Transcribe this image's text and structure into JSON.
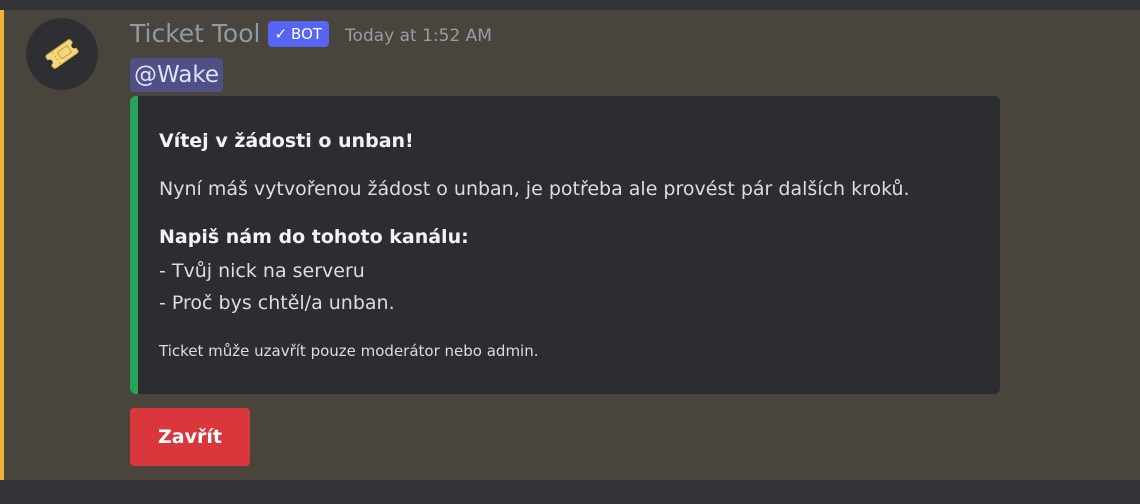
{
  "message": {
    "author": "Ticket Tool",
    "badge": {
      "check": "✓",
      "label": "BOT",
      "color": "#5865f2"
    },
    "timestamp": "Today at 1:52 AM",
    "mention": "@Wake",
    "avatar_icon": "ticket-icon"
  },
  "embed": {
    "accent_color": "#23a55a",
    "title": "Vítej v žádosti o unban!",
    "description": "Nyní máš vytvořenou žádost o unban, je potřeba ale provést pár dalších kroků.",
    "field": {
      "name": "Napiš nám do tohoto kanálu:",
      "lines": [
        "- Tvůj nick na serveru",
        "- Proč bys chtěl/a unban."
      ]
    },
    "footer": "Ticket může uzavřít pouze moderátor nebo admin."
  },
  "buttons": {
    "close_label": "Zavřít",
    "close_color": "#da373c"
  },
  "colors": {
    "mention_highlight": "#49443c",
    "mention_bar": "#f0b232"
  }
}
